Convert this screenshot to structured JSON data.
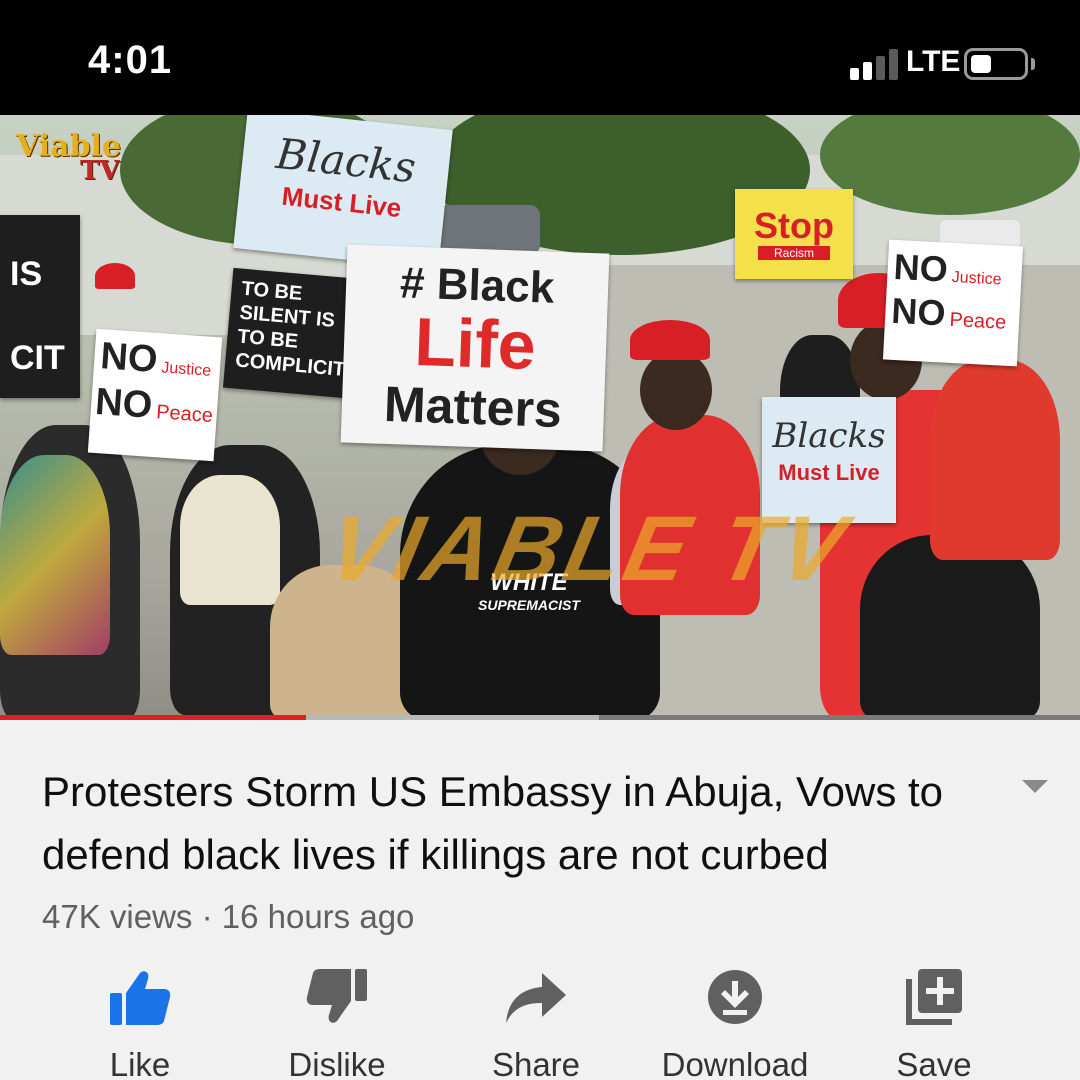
{
  "status_bar": {
    "time": "4:01",
    "network": "LTE",
    "signal_bars": 2,
    "signal_total": 4
  },
  "video": {
    "channel_logo": {
      "line1": "Viable",
      "line2": "TV"
    },
    "watermark": "VIABLE TV",
    "signs": {
      "blacks_must_live_top": {
        "script": "Blacks",
        "text": "Must Live"
      },
      "black_life_matters": {
        "hash": "# Black",
        "life": "Life",
        "matters": "Matters"
      },
      "stop_racism": {
        "stop": "Stop",
        "racism": "Racism"
      },
      "to_be_silent": {
        "lines": [
          "TO BE",
          "SILENT IS",
          "TO BE",
          "COMPLICIT"
        ]
      },
      "racism_partial": {
        "top": "IS",
        "bottom": "CIT"
      },
      "no_justice_left": {
        "no1": "NO",
        "justice": "Justice",
        "no2": "NO",
        "peace": "Peace"
      },
      "no_justice_right": {
        "no1": "NO",
        "justice": "Justice",
        "no2": "NO",
        "peace": "Peace"
      },
      "blacks_must_live_right": {
        "script": "Blacks",
        "text": "Must Live"
      },
      "shirt": {
        "line1": "WHITE",
        "line2": "SUPREMACIST"
      }
    },
    "progress": {
      "played_fraction": 0.283,
      "buffered_fraction": 0.555
    }
  },
  "info": {
    "title": "Protesters Storm US Embassy in Abuja, Vows to defend black lives if killings are not curbed",
    "views": "47K views",
    "separator": "·",
    "age": "16 hours ago"
  },
  "actions": [
    {
      "label": "Like",
      "icon": "thumbs-up-icon",
      "active": true
    },
    {
      "label": "Dislike",
      "icon": "thumbs-down-icon",
      "active": false
    },
    {
      "label": "Share",
      "icon": "share-arrow-icon",
      "active": false
    },
    {
      "label": "Download",
      "icon": "download-icon",
      "active": false
    },
    {
      "label": "Save",
      "icon": "add-to-playlist-icon",
      "active": false
    }
  ],
  "colors": {
    "like_active": "#1a73e8",
    "icon_default": "#606060",
    "progress_played": "#e02020",
    "sign_red": "#d81f26"
  }
}
